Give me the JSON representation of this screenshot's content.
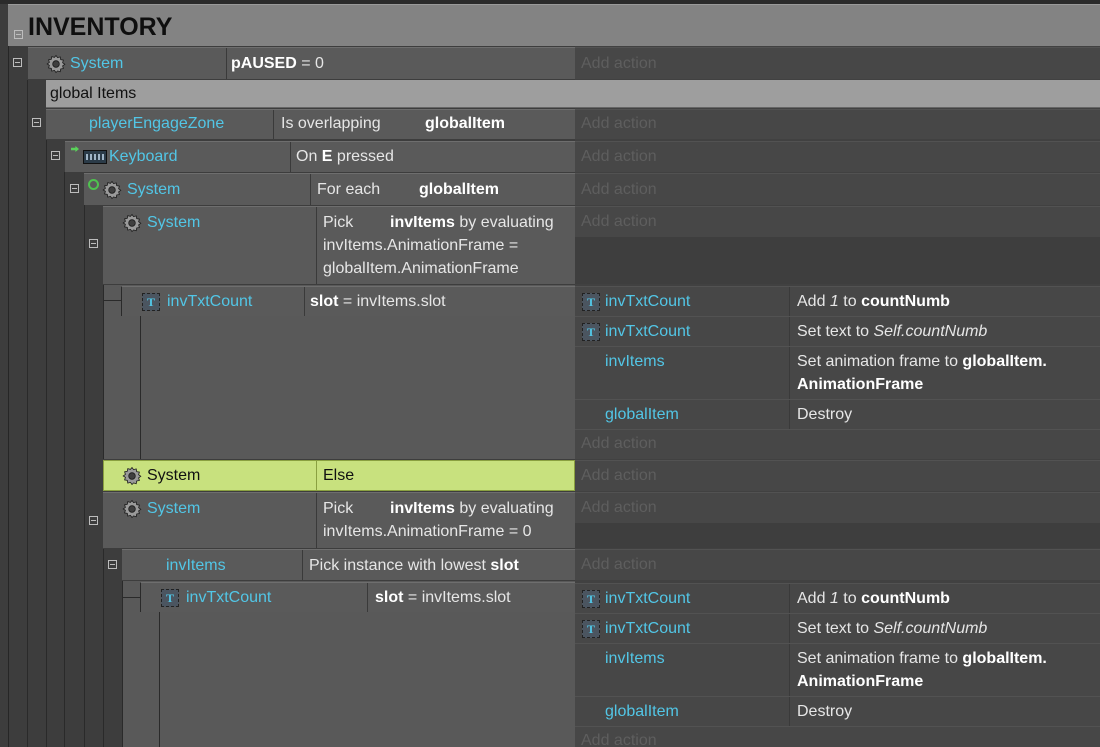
{
  "group": {
    "title": "INVENTORY"
  },
  "rows": {
    "paused": {
      "object": "System",
      "cond_name": "pAUSED",
      "cond_op": " = 0"
    },
    "comment": "global Items",
    "overlap": {
      "object": "playerEngageZone",
      "cond_text": "Is overlapping",
      "cond_bold": "globalItem"
    },
    "keyboard": {
      "object": "Keyboard",
      "cond_pre": "On ",
      "cond_bold": "E",
      "cond_post": " pressed"
    },
    "foreach": {
      "object": "System",
      "cond_text": "For each",
      "cond_bold": "globalItem"
    },
    "pick1": {
      "object": "System",
      "cond_pre": "Pick",
      "cond_bold": "invItems",
      "cond_post": " by evaluating",
      "line2": "invItems.AnimationFrame =",
      "line3": "globalItem.AnimationFrame"
    },
    "slot1": {
      "object": "invTxtCount",
      "cond_bold": "slot",
      "cond_post": " = invItems.slot"
    },
    "else": {
      "object": "System",
      "cond_text": "Else"
    },
    "pick2": {
      "object": "System",
      "cond_pre": "Pick",
      "cond_bold": "invItems",
      "cond_post": " by evaluating",
      "line2": "invItems.AnimationFrame = 0"
    },
    "lowest": {
      "object": "invItems",
      "cond_pre": "Pick instance with lowest ",
      "cond_bold": "slot"
    },
    "slot2": {
      "object": "invTxtCount",
      "cond_bold": "slot",
      "cond_post": " = invItems.slot"
    }
  },
  "add_action": "Add action",
  "actions1": [
    {
      "object": "invTxtCount",
      "pre": "Add ",
      "ital": "1",
      "mid": " to ",
      "bold": "countNumb"
    },
    {
      "object": "invTxtCount",
      "pre": "Set text to ",
      "ital": "Self.countNumb"
    },
    {
      "object": "invItems",
      "pre": "Set animation frame to ",
      "bold": "globalItem.",
      "line2": "AnimationFrame"
    },
    {
      "object": "globalItem",
      "pre": "Destroy"
    }
  ],
  "actions2": [
    {
      "object": "invTxtCount",
      "pre": "Add ",
      "ital": "1",
      "mid": " to ",
      "bold": "countNumb"
    },
    {
      "object": "invTxtCount",
      "pre": "Set text to ",
      "ital": "Self.countNumb"
    },
    {
      "object": "invItems",
      "pre": "Set animation frame to ",
      "bold": "globalItem.",
      "line2": "AnimationFrame"
    },
    {
      "object": "globalItem",
      "pre": "Destroy"
    }
  ],
  "colors": {
    "object_link": "#52c6e6",
    "else_highlight": "#c8e17e",
    "comment_bg": "#9e9e9e"
  }
}
